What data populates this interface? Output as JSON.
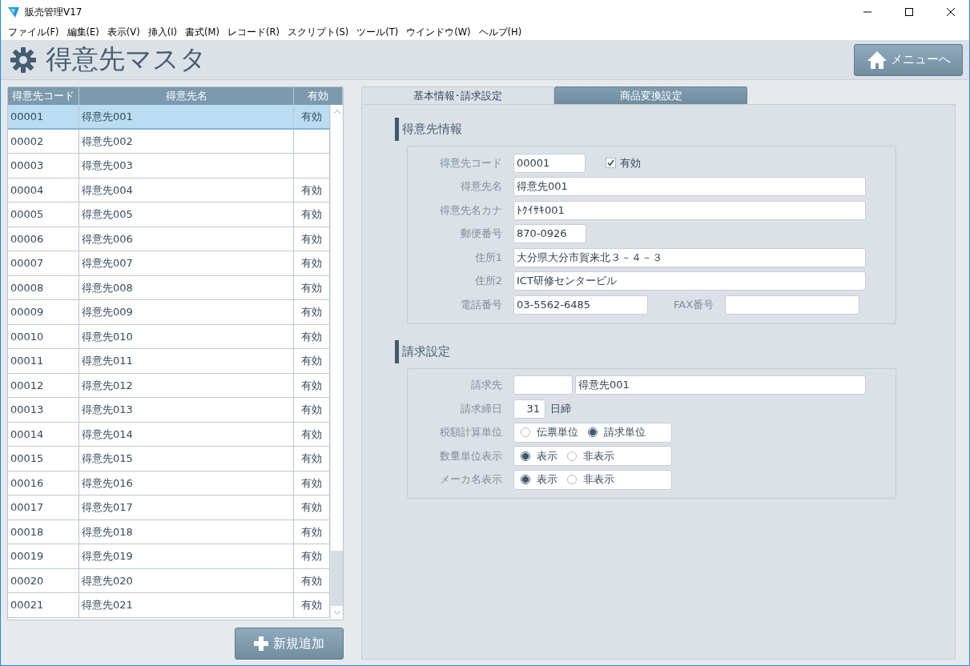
{
  "window": {
    "title": "販売管理V17"
  },
  "menu": [
    "ファイル(F)",
    "編集(E)",
    "表示(V)",
    "挿入(I)",
    "書式(M)",
    "レコード(R)",
    "スクリプト(S)",
    "ツール(T)",
    "ウインドウ(W)",
    "ヘルプ(H)"
  ],
  "header": {
    "title": "得意先マスタ",
    "menu_button": "メニューへ"
  },
  "table": {
    "columns": [
      "得意先コード",
      "得意先名",
      "有効"
    ],
    "rows": [
      {
        "code": "00001",
        "name": "得意先001",
        "active": "有効",
        "selected": true
      },
      {
        "code": "00002",
        "name": "得意先002",
        "selected": false
      },
      {
        "code": "00003",
        "name": "得意先003",
        "selected": false
      },
      {
        "code": "00004",
        "name": "得意先004",
        "active": "有効",
        "selected": false
      },
      {
        "code": "00005",
        "name": "得意先005",
        "active": "有効",
        "selected": false
      },
      {
        "code": "00006",
        "name": "得意先006",
        "active": "有効",
        "selected": false
      },
      {
        "code": "00007",
        "name": "得意先007",
        "active": "有効",
        "selected": false
      },
      {
        "code": "00008",
        "name": "得意先008",
        "active": "有効",
        "selected": false
      },
      {
        "code": "00009",
        "name": "得意先009",
        "active": "有効",
        "selected": false
      },
      {
        "code": "00010",
        "name": "得意先010",
        "active": "有効",
        "selected": false
      },
      {
        "code": "00011",
        "name": "得意先011",
        "active": "有効",
        "selected": false
      },
      {
        "code": "00012",
        "name": "得意先012",
        "active": "有効",
        "selected": false
      },
      {
        "code": "00013",
        "name": "得意先013",
        "active": "有効",
        "selected": false
      },
      {
        "code": "00014",
        "name": "得意先014",
        "active": "有効",
        "selected": false
      },
      {
        "code": "00015",
        "name": "得意先015",
        "active": "有効",
        "selected": false
      },
      {
        "code": "00016",
        "name": "得意先016",
        "active": "有効",
        "selected": false
      },
      {
        "code": "00017",
        "name": "得意先017",
        "active": "有効",
        "selected": false
      },
      {
        "code": "00018",
        "name": "得意先018",
        "active": "有効",
        "selected": false
      },
      {
        "code": "00019",
        "name": "得意先019",
        "active": "有効",
        "selected": false
      },
      {
        "code": "00020",
        "name": "得意先020",
        "active": "有効",
        "selected": false
      },
      {
        "code": "00021",
        "name": "得意先021",
        "active": "有効",
        "selected": false
      }
    ]
  },
  "add_button": "新規追加",
  "tabs": [
    {
      "label": "基本情報･請求設定",
      "selected": true
    },
    {
      "label": "商品変換設定",
      "selected": false
    }
  ],
  "sections": [
    {
      "title": "得意先情報",
      "rows": [
        {
          "kind": "code",
          "label": "得意先コード",
          "value": "00001",
          "checkbox": {
            "label": "有効",
            "checked": true
          }
        },
        {
          "kind": "wide",
          "label": "得意先名",
          "value": "得意先001"
        },
        {
          "kind": "wide",
          "label": "得意先名カナ",
          "value": "ﾄｸｲｻｷ001"
        },
        {
          "kind": "short",
          "label": "郵便番号",
          "value": "870-0926"
        },
        {
          "kind": "wide",
          "label": "住所1",
          "value": "大分県大分市賀来北３－４－３"
        },
        {
          "kind": "wide",
          "label": "住所2",
          "value": "ICT研修センタービル"
        },
        {
          "kind": "pair",
          "label": "電話番号",
          "value": "03-5562-6485",
          "label2": "FAX番号"
        }
      ]
    },
    {
      "title": "請求設定",
      "rows": [
        {
          "kind": "lookup",
          "label": "請求先",
          "value2": "得意先001"
        },
        {
          "kind": "day",
          "label": "請求締日",
          "value": "31",
          "suffix": "日締"
        },
        {
          "kind": "radio",
          "label": "税額計算単位",
          "options": [
            {
              "label": "伝票単位",
              "selected": false
            },
            {
              "label": "請求単位",
              "selected": true
            }
          ]
        },
        {
          "kind": "radio",
          "label": "数量単位表示",
          "options": [
            {
              "label": "表示",
              "selected": true
            },
            {
              "label": "非表示",
              "selected": false
            }
          ]
        },
        {
          "kind": "radio",
          "label": "メーカ名表示",
          "options": [
            {
              "label": "表示",
              "selected": true
            },
            {
              "label": "非表示",
              "selected": false
            }
          ]
        }
      ]
    }
  ]
}
